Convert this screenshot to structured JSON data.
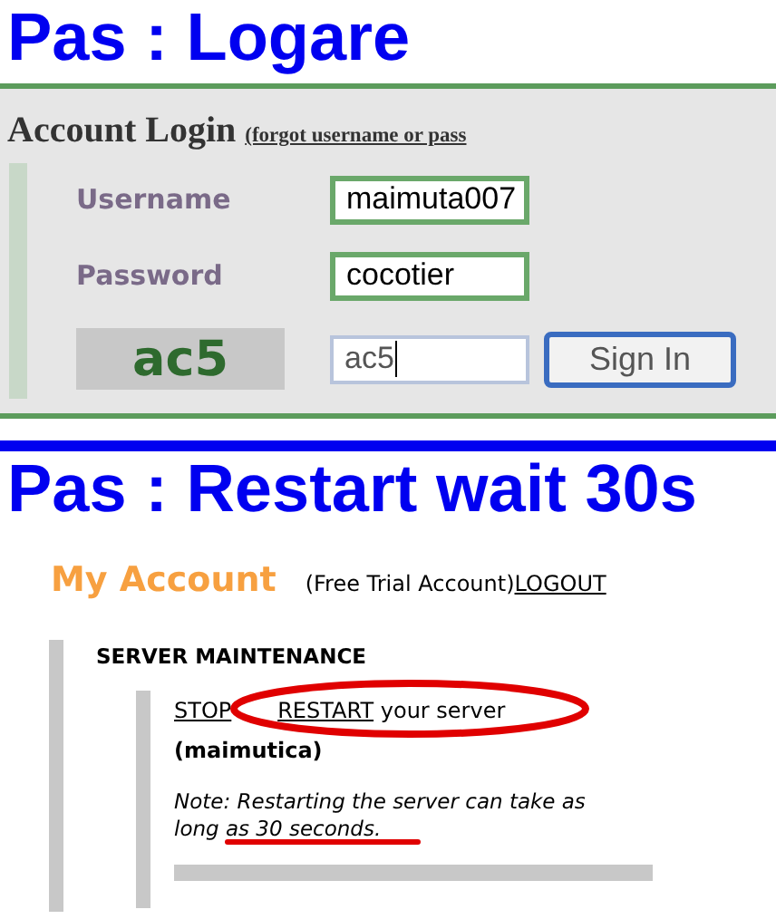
{
  "steps": [
    {
      "kind": "login",
      "title": "Pas : Logare",
      "login": {
        "heading": "Account Login",
        "forgot_link": "(forgot username or pass",
        "fields": [
          {
            "label": "Username",
            "value": "maimuta007"
          },
          {
            "label": "Password",
            "value": "cocotier"
          }
        ],
        "captcha": {
          "code": "ac5",
          "value": "ac5"
        },
        "submit": "Sign In"
      }
    },
    {
      "kind": "server",
      "title": "Pas : Restart wait 30s",
      "account": {
        "heading": "My Account",
        "plan": "(Free Trial Account)",
        "logout": "LOGOUT",
        "section": "SERVER MAINTENANCE",
        "stop": "STOP",
        "restart": "RESTART",
        "action_text": "your server",
        "server_name": "(maimutica)",
        "note_lead": "Note: Restarting the server can take as long ",
        "note_emphasis": "as 30 seconds."
      }
    }
  ]
}
